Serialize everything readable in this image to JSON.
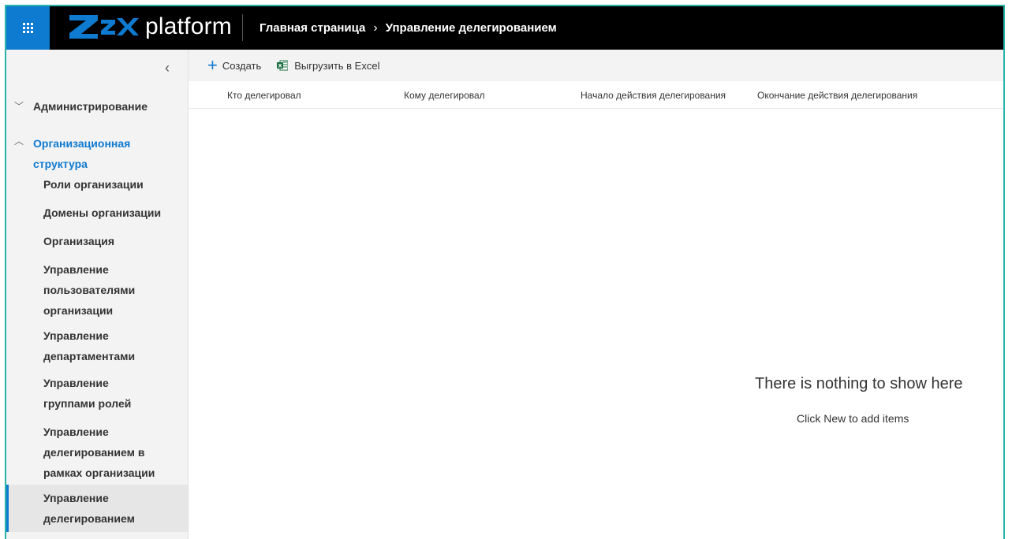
{
  "app": {
    "logo_text": "platform"
  },
  "breadcrumb": {
    "home": "Главная страница",
    "separator": "›",
    "current": "Управление делегированием"
  },
  "sidebar": {
    "collapse_icon": "chevron-left-icon",
    "groups": [
      {
        "label": "Администрирование",
        "expanded": false
      },
      {
        "label": "Организационная структура",
        "expanded": true
      }
    ],
    "items": [
      {
        "label": "Роли организации"
      },
      {
        "label": "Домены организации"
      },
      {
        "label": "Организация"
      },
      {
        "label": "Управление пользователями организации"
      },
      {
        "label": "Управление департаментами"
      },
      {
        "label": "Управление группами ролей"
      },
      {
        "label": "Управление делегированием в рамках организации"
      },
      {
        "label": "Управление делегированием",
        "active": true
      }
    ]
  },
  "commandbar": {
    "create_label": "Создать",
    "export_label": "Выгрузить в Excel"
  },
  "table": {
    "columns": [
      "Кто делегировал",
      "Кому делегировал",
      "Начало действия делегирования",
      "Окончание действия делегирования"
    ]
  },
  "empty_state": {
    "title": "There is nothing to show here",
    "subtitle": "Click New to add items"
  },
  "colors": {
    "accent": "#0e7ad0",
    "topbar": "#000000",
    "frame": "#2ab3a6"
  }
}
